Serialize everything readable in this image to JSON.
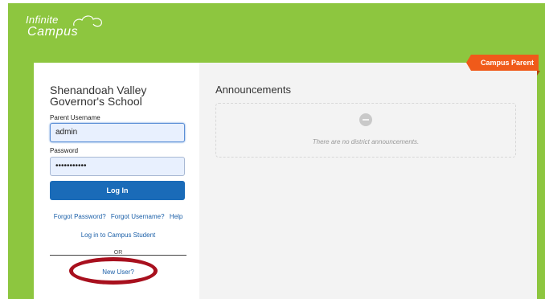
{
  "logo": {
    "line1": "Infinite",
    "line2": "Campus"
  },
  "badge": {
    "label": "Campus Parent"
  },
  "login": {
    "school_name": "Shenandoah Valley Governor's School",
    "username_label": "Parent Username",
    "username_value": "admin",
    "password_label": "Password",
    "password_value": "•••••••••••",
    "login_button": "Log In",
    "forgot_password": "Forgot Password?",
    "forgot_username": "Forgot Username?",
    "help": "Help",
    "student_link": "Log in to Campus Student",
    "or_text": "OR",
    "new_user": "New User?"
  },
  "announcements": {
    "title": "Announcements",
    "empty_text": "There are no district announcements."
  },
  "colors": {
    "brand_green": "#8dc63f",
    "badge_orange": "#f05a1a",
    "button_blue": "#1a6bb8",
    "highlight_red": "#a8101e"
  },
  "icons": {
    "empty_state": "no-entry-icon",
    "logo_swirl": "cloud-swirl-icon"
  }
}
